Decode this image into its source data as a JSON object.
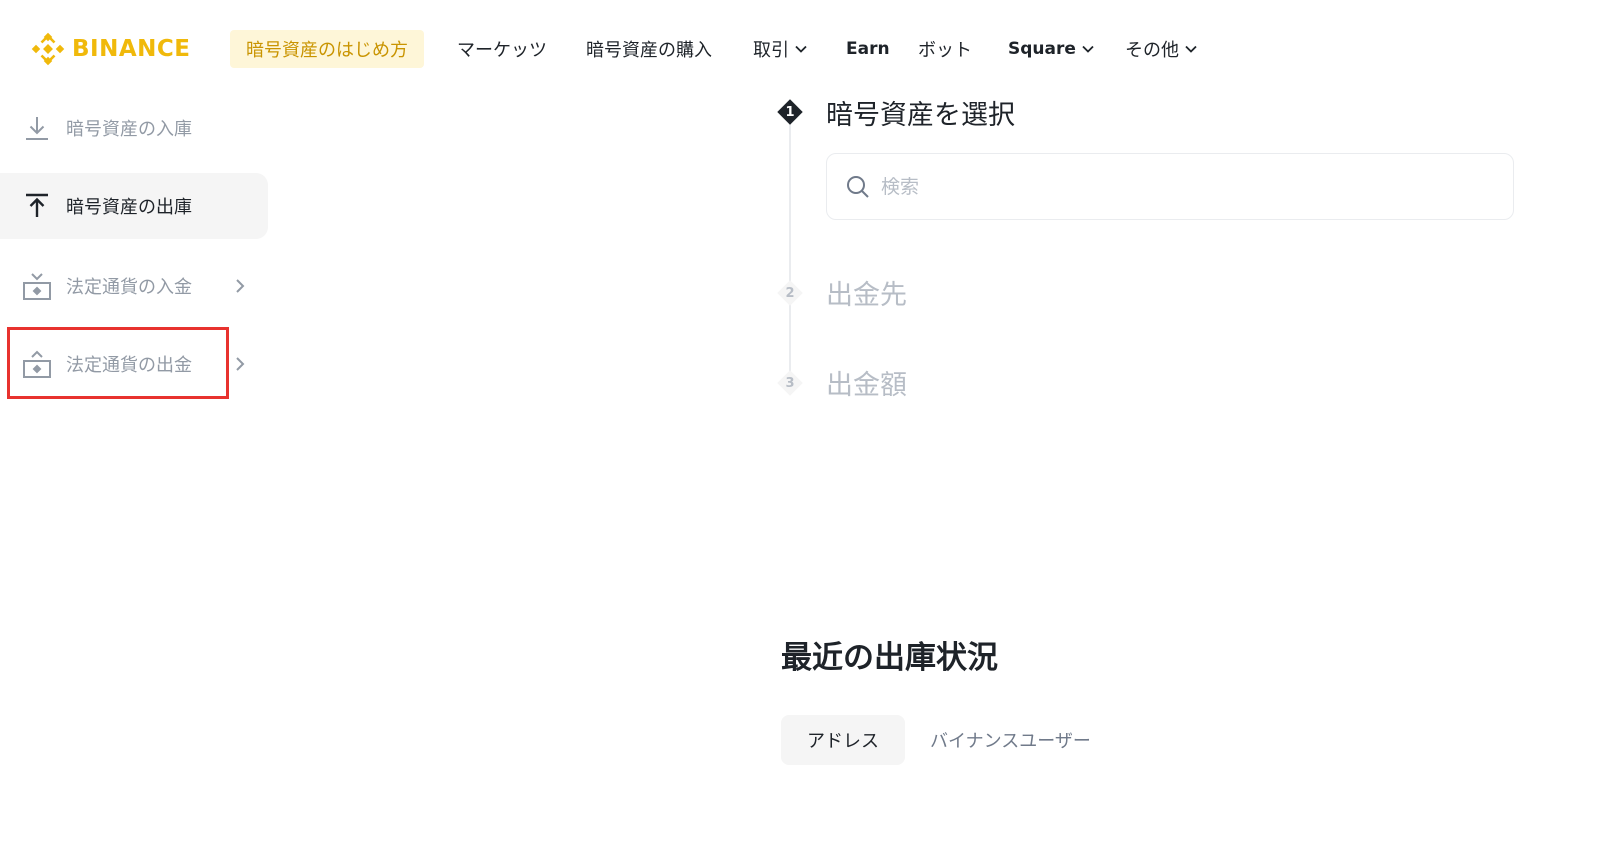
{
  "brand": {
    "name": "BINANCE",
    "color": "#f0b90b"
  },
  "nav": {
    "items": [
      {
        "label": "暗号資産のはじめ方",
        "highlight": true
      },
      {
        "label": "マーケッツ"
      },
      {
        "label": "暗号資産の購入"
      },
      {
        "label": "取引",
        "dropdown": true
      },
      {
        "label": "Earn"
      },
      {
        "label": "ボット"
      },
      {
        "label": "Square",
        "dropdown": true
      },
      {
        "label": "その他",
        "dropdown": true
      }
    ]
  },
  "sidebar": {
    "items": [
      {
        "label": "暗号資産の入庫",
        "icon": "download-icon",
        "active": false
      },
      {
        "label": "暗号資産の出庫",
        "icon": "upload-icon",
        "active": true
      },
      {
        "label": "法定通貨の入金",
        "icon": "fiat-deposit-icon",
        "active": false,
        "has_submenu": true
      },
      {
        "label": "法定通貨の出金",
        "icon": "fiat-withdraw-icon",
        "active": false,
        "has_submenu": true
      }
    ]
  },
  "steps": [
    {
      "number": "1",
      "title": "暗号資産を選択",
      "active": true
    },
    {
      "number": "2",
      "title": "出金先",
      "active": false
    },
    {
      "number": "3",
      "title": "出金額",
      "active": false
    }
  ],
  "search": {
    "placeholder": "検索",
    "value": ""
  },
  "recent": {
    "title": "最近の出庫状況",
    "tabs": [
      {
        "label": "アドレス",
        "active": true
      },
      {
        "label": "バイナンスユーザー",
        "active": false
      }
    ]
  },
  "colors": {
    "highlight_box": "#e8322e",
    "text_primary": "#1e2329",
    "text_muted": "#929aa5"
  }
}
